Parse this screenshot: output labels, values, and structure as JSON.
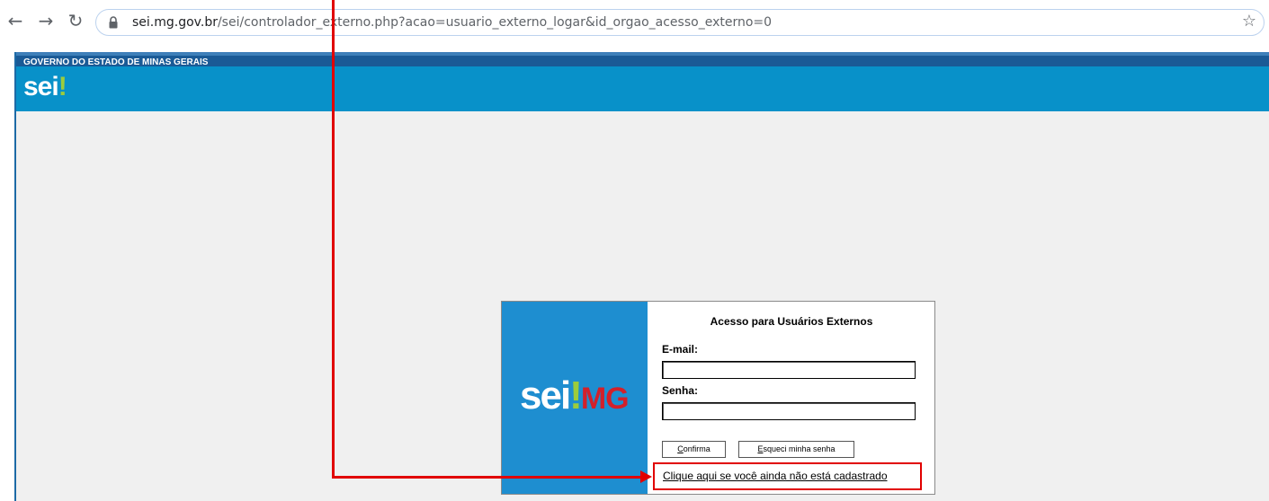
{
  "browser": {
    "back_icon": "arrow-left-icon",
    "forward_icon": "arrow-right-icon",
    "reload_icon": "reload-icon",
    "url_host": "sei.mg.gov.br",
    "url_path": "/sei/controlador_externo.php?acao=usuario_externo_logar&id_orgao_acesso_externo=0",
    "bookmark_icon": "star-icon"
  },
  "header": {
    "gov_title": "GOVERNO DO ESTADO DE MINAS GERAIS",
    "logo_text": "sei",
    "logo_bang": "!"
  },
  "login": {
    "logo_sei": "sei",
    "logo_bang": "!",
    "logo_mg": "MG",
    "title": "Acesso para Usuários Externos",
    "email_label": "E-mail:",
    "email_value": "",
    "senha_label": "Senha:",
    "senha_value": "",
    "confirm_first": "C",
    "confirm_rest": "onfirma",
    "forgot_first": "E",
    "forgot_rest": "squeci minha senha",
    "register_link": "Clique aqui se você ainda não está cadastrado"
  },
  "colors": {
    "header_band": "#0891c9",
    "gov_strip": "#1a5a96",
    "logo_panel": "#1e8ed0",
    "annotation": "#e10000"
  }
}
